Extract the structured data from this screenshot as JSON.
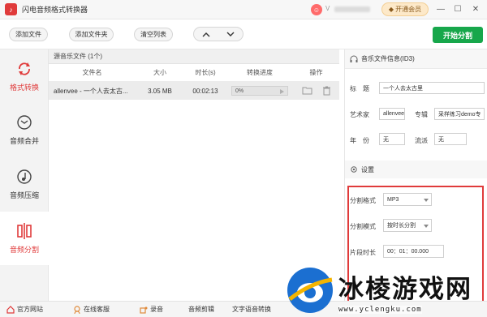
{
  "window": {
    "title": "闪电音频格式转换器",
    "vip_label": "开通会员",
    "user_badge": "V"
  },
  "toolbar": {
    "add_file": "添加文件",
    "add_folder": "添加文件夹",
    "clear_list": "清空列表",
    "up": "∧",
    "down": "∨",
    "start": "开始分割"
  },
  "sidebar": {
    "items": [
      {
        "label": "格式转换",
        "icon": "refresh-icon"
      },
      {
        "label": "音频合并",
        "icon": "merge-icon"
      },
      {
        "label": "音频压缩",
        "icon": "music-note-icon"
      },
      {
        "label": "音频分割",
        "icon": "split-icon",
        "active": true
      }
    ]
  },
  "file_list": {
    "header": "源音乐文件 (1个)",
    "columns": [
      "文件名",
      "大小",
      "时长(s)",
      "转换进度",
      "操作"
    ],
    "rows": [
      {
        "name": "allenvee - 一个人去太古...",
        "size": "3.05 MB",
        "duration": "00:02:13",
        "progress": "0%",
        "progress_value": 0
      }
    ]
  },
  "info": {
    "title": "音乐文件信息(ID3)",
    "fields": {
      "title_label": "标　题",
      "title_value": "一个人去太古里",
      "artist_label": "艺术家",
      "artist_value": "allenvee",
      "album_label": "专辑",
      "album_value": "采样练习demo专",
      "year_label": "年　份",
      "year_value": "无",
      "genre_label": "流派",
      "genre_value": "无"
    }
  },
  "settings": {
    "title": "设置",
    "format_label": "分割格式",
    "format_value": "MP3",
    "mode_label": "分割模式",
    "mode_value": "按时长分割",
    "duration_label": "片段时长",
    "duration_value": "00：01：00.000"
  },
  "bottombar": {
    "items": [
      "官方网站",
      "在线客服",
      "录音",
      "音频剪辑",
      "文字语音转换"
    ]
  },
  "watermark": {
    "text": "冰棱游戏网",
    "url": "www.yclengku.com"
  },
  "colors": {
    "accent_red": "#e03b3b",
    "start_green": "#17a74b"
  }
}
